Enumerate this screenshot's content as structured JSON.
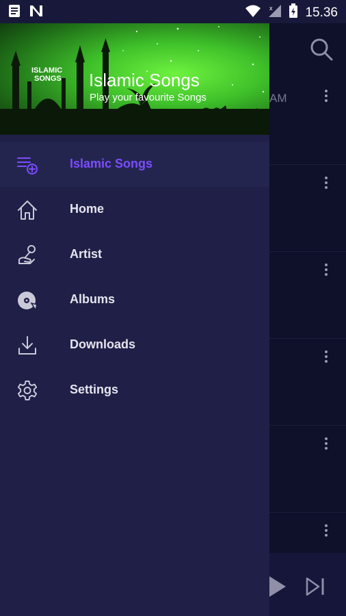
{
  "status_bar": {
    "time": "15.36",
    "left_icons": [
      "notes-icon",
      "n-app-icon"
    ],
    "right_icons": [
      "wifi-icon",
      "signal-icon",
      "battery-icon"
    ]
  },
  "background": {
    "partial_text": "AM",
    "row_count": 6
  },
  "drawer": {
    "header": {
      "title": "Islamic Songs",
      "subtitle": "Play your favourite Songs",
      "banner_text_line1": "ISLAMIC",
      "banner_text_line2": "SONGS"
    },
    "menu": [
      {
        "label": "Islamic Songs",
        "icon": "playlist-add-icon",
        "active": true
      },
      {
        "label": "Home",
        "icon": "home-icon",
        "active": false
      },
      {
        "label": "Artist",
        "icon": "artist-icon",
        "active": false
      },
      {
        "label": "Albums",
        "icon": "album-icon",
        "active": false
      },
      {
        "label": "Downloads",
        "icon": "download-icon",
        "active": false
      },
      {
        "label": "Settings",
        "icon": "settings-icon",
        "active": false
      }
    ]
  },
  "colors": {
    "drawer_bg": "#1f1f47",
    "active_accent": "#7c4dff",
    "header_green": "#3fc12a",
    "statusbar_bg": "#18193a"
  }
}
